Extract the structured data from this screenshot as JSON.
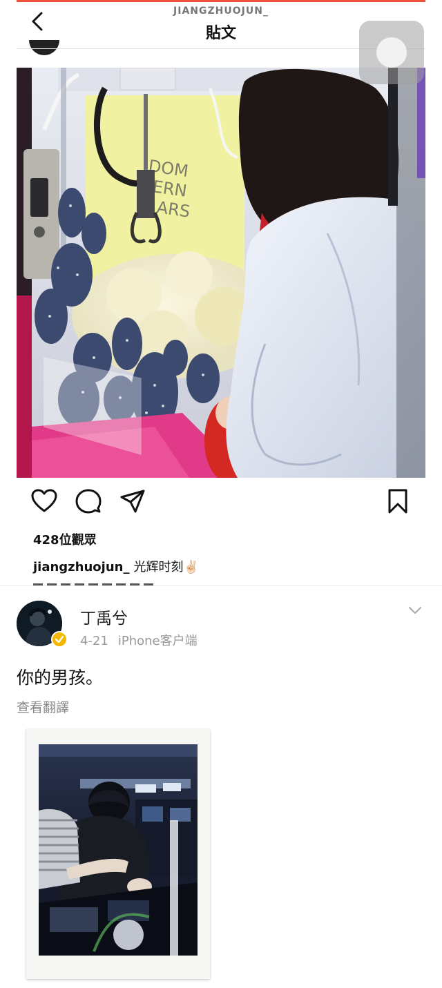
{
  "instagram": {
    "username_top": "JIANGZHUOJUN_",
    "title": "貼文",
    "views": "428位觀眾",
    "caption_user": "jiangzhuojun_",
    "caption_text": "光辉时刻✌🏻",
    "machine_sign": "DOM\nERN\nARS",
    "icons": [
      "back-arrow-icon",
      "heart-icon",
      "comment-icon",
      "share-icon",
      "bookmark-icon"
    ],
    "accent_color": "#f0533c"
  },
  "weibo": {
    "name": "丁禹兮",
    "date": "4-21",
    "source": "iPhone客户端",
    "text": "你的男孩。",
    "translate_label": "查看翻譯",
    "verified_color": "#f5b800",
    "icons": [
      "chevron-down-icon",
      "verified-badge-icon"
    ]
  }
}
